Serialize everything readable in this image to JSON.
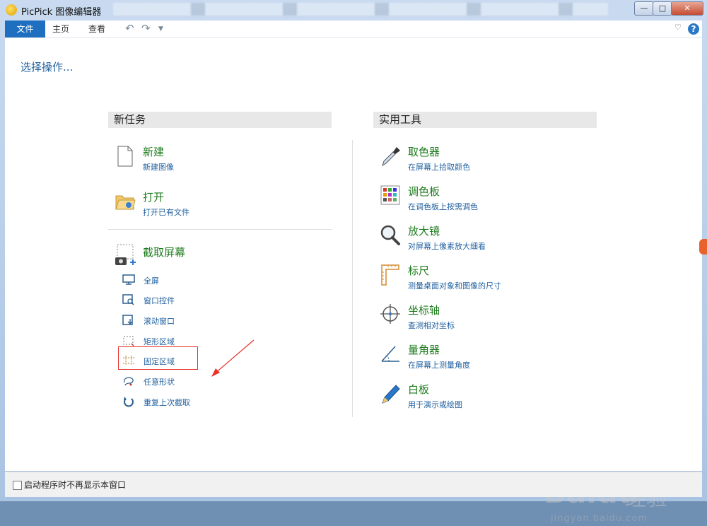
{
  "window": {
    "title": "PicPick 图像编辑器"
  },
  "ribbon": {
    "tabs": [
      "文件",
      "主页",
      "查看"
    ]
  },
  "main": {
    "heading": "选择操作...",
    "new_task": {
      "header": "新任务",
      "new": {
        "name": "新建",
        "desc": "新建图像"
      },
      "open": {
        "name": "打开",
        "desc": "打开已有文件"
      },
      "capture": {
        "name": "截取屏幕",
        "options": [
          "全屏",
          "窗口控件",
          "滚动窗口",
          "矩形区域",
          "固定区域",
          "任意形状",
          "重复上次截取"
        ]
      }
    },
    "tools": {
      "header": "实用工具",
      "items": [
        {
          "name": "取色器",
          "desc": "在屏幕上拾取颜色",
          "icon": "eyedropper-icon"
        },
        {
          "name": "调色板",
          "desc": "在调色板上按需调色",
          "icon": "palette-icon"
        },
        {
          "name": "放大镜",
          "desc": "对屏幕上像素放大细看",
          "icon": "magnifier-icon"
        },
        {
          "name": "标尺",
          "desc": "测量桌面对象和图像的尺寸",
          "icon": "ruler-icon"
        },
        {
          "name": "坐标轴",
          "desc": "查测相对坐标",
          "icon": "crosshair-icon"
        },
        {
          "name": "量角器",
          "desc": "在屏幕上测量角度",
          "icon": "protractor-icon"
        },
        {
          "name": "白板",
          "desc": "用于演示或绘图",
          "icon": "pen-icon"
        }
      ]
    }
  },
  "footer": {
    "checkbox_label": "启动程序时不再显示本窗口",
    "checked": false
  },
  "watermark": {
    "brand": "Baidu",
    "cn": "经验",
    "url": "jingyan.baidu.com"
  },
  "colors": {
    "accent": "#1e6fbf",
    "item_name": "#1d7b1d",
    "link": "#1f5f9e",
    "highlight": "#e8312a"
  }
}
